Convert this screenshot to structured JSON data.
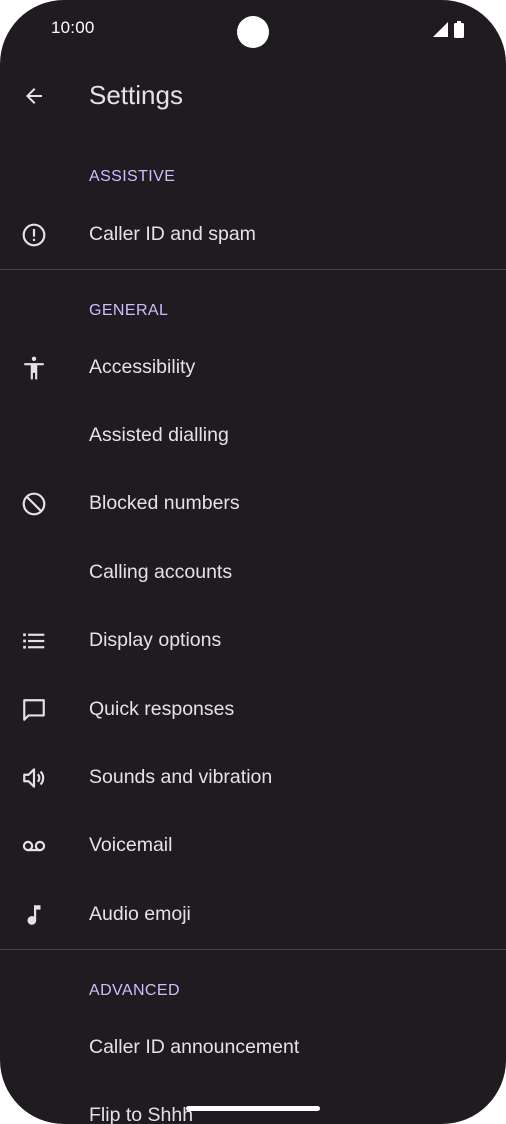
{
  "status_bar": {
    "time": "10:00",
    "icons": [
      "signal-icon",
      "battery-icon"
    ]
  },
  "app_bar": {
    "title": "Settings",
    "back_icon": "arrow-back-icon"
  },
  "sections": {
    "assistive": {
      "header": "ASSISTIVE",
      "items": [
        {
          "label": "Caller ID and spam",
          "icon": "alert-circle-icon"
        }
      ]
    },
    "general": {
      "header": "GENERAL",
      "items": [
        {
          "label": "Accessibility",
          "icon": "accessibility-icon"
        },
        {
          "label": "Assisted dialling",
          "icon": ""
        },
        {
          "label": "Blocked numbers",
          "icon": "block-icon"
        },
        {
          "label": "Calling accounts",
          "icon": ""
        },
        {
          "label": "Display options",
          "icon": "list-icon"
        },
        {
          "label": "Quick responses",
          "icon": "chat-bubble-icon"
        },
        {
          "label": "Sounds and vibration",
          "icon": "volume-icon"
        },
        {
          "label": "Voicemail",
          "icon": "voicemail-icon"
        },
        {
          "label": "Audio emoji",
          "icon": "music-note-icon"
        }
      ]
    },
    "advanced": {
      "header": "ADVANCED",
      "items": [
        {
          "label": "Caller ID announcement",
          "icon": ""
        },
        {
          "label": "Flip to Shhh",
          "icon": ""
        }
      ]
    }
  },
  "colors": {
    "background": "#1f1b21",
    "text": "#e6e1e6",
    "accent": "#d0bcff",
    "divider": "#49454f"
  }
}
